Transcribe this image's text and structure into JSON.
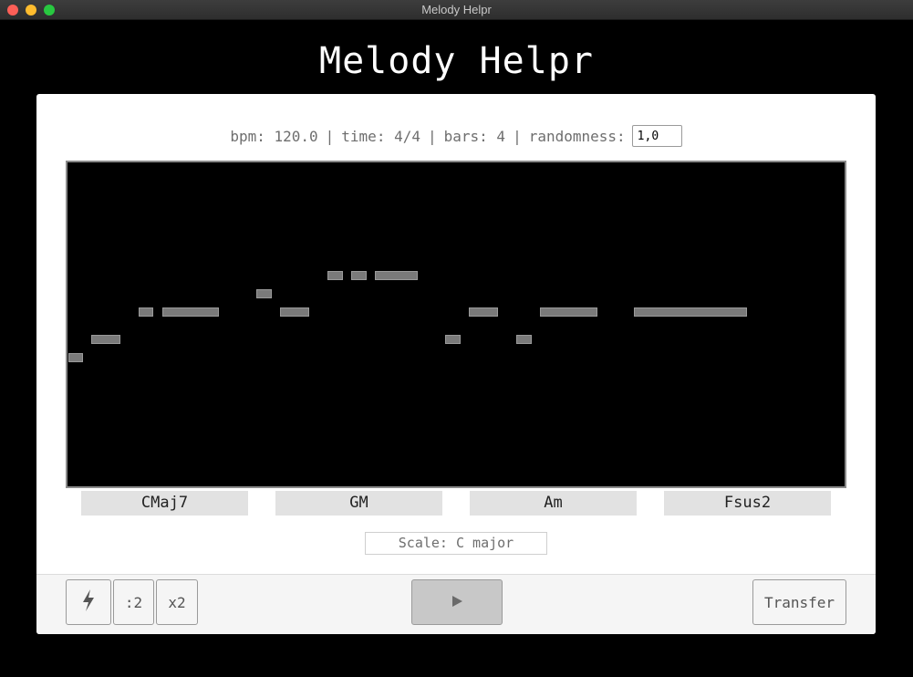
{
  "window": {
    "title": "Melody Helpr"
  },
  "app": {
    "title": "Melody Helpr"
  },
  "settings": {
    "bpm_text": "bpm: 120.0",
    "time_text": "time: 4/4",
    "bars_text": "bars: 4",
    "randomness_label": "randomness:",
    "randomness_value": "1,0",
    "separator": "|"
  },
  "chords": [
    "CMaj7",
    "GM",
    "Am",
    "Fsus2"
  ],
  "scale": {
    "label": "Scale: C major"
  },
  "toolbar": {
    "bolt_icon": "lightning-bolt-icon",
    "half_label": ":2",
    "double_label": "x2",
    "play_icon": "play-icon",
    "transfer_label": "Transfer"
  },
  "colors": {
    "background": "#000000",
    "panel": "#ffffff",
    "note": "#7a7a7a",
    "chord_bg": "#e2e2e2",
    "close": "#fe5f57",
    "minimize": "#febc2e",
    "maximize": "#28c840"
  }
}
